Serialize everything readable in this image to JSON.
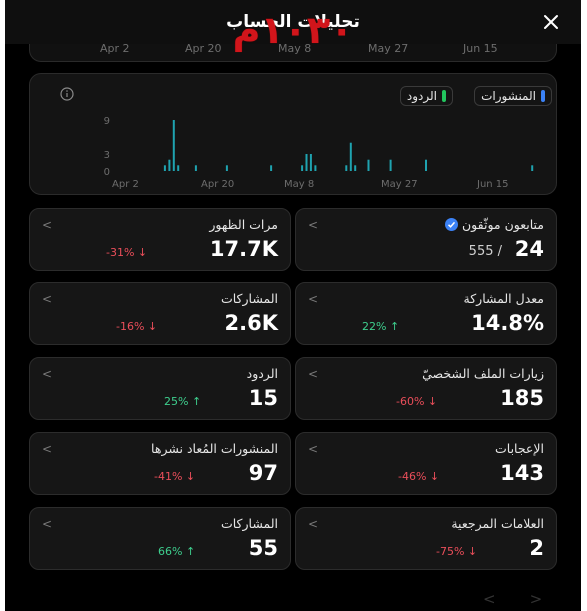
{
  "header": {
    "title": "تحليلات الحساب",
    "watermark": "١٠٣٠م"
  },
  "top_strip": {
    "dates": [
      "Apr 2",
      "Apr 20",
      "May 8",
      "May 27",
      "Jun 15"
    ]
  },
  "chart_data": {
    "type": "bar",
    "series": [
      {
        "name": "المنشورات",
        "color": "#3b82f6"
      },
      {
        "name": "الردود",
        "color": "#22c55e"
      }
    ],
    "x_ticks": [
      "Apr 2",
      "Apr 20",
      "May 8",
      "May 27",
      "Jun 15"
    ],
    "y_ticks": [
      0,
      3,
      9
    ],
    "ylim": [
      0,
      9
    ],
    "bars": [
      {
        "x": "Apr 16",
        "y": 1
      },
      {
        "x": "Apr 17",
        "y": 2
      },
      {
        "x": "Apr 18",
        "y": 9
      },
      {
        "x": "Apr 19",
        "y": 1
      },
      {
        "x": "Apr 23",
        "y": 1
      },
      {
        "x": "Apr 30",
        "y": 1
      },
      {
        "x": "May 10",
        "y": 1
      },
      {
        "x": "May 17",
        "y": 1
      },
      {
        "x": "May 18",
        "y": 3
      },
      {
        "x": "May 19",
        "y": 3
      },
      {
        "x": "May 20",
        "y": 1
      },
      {
        "x": "May 27",
        "y": 1
      },
      {
        "x": "May 28",
        "y": 5
      },
      {
        "x": "May 29",
        "y": 1
      },
      {
        "x": "Jun 1",
        "y": 2
      },
      {
        "x": "Jun 6",
        "y": 2
      },
      {
        "x": "Jun 14",
        "y": 2
      },
      {
        "x": "Jul 8",
        "y": 1
      }
    ],
    "legend_position": "top-right",
    "grid": false
  },
  "stats": {
    "verified_followers": {
      "label": "متابعون موثّقون",
      "value": "24",
      "sub": "555 /"
    },
    "impressions": {
      "label": "مرات الظهور",
      "value": "17.7K",
      "change": "-31% ↓"
    },
    "engagement_rate": {
      "label": "معدل المشاركة",
      "value": "14.8%",
      "change": "22% ↑"
    },
    "engagements": {
      "label": "المشاركات",
      "value": "2.6K",
      "change": "-16% ↓"
    },
    "profile_visits": {
      "label": "زيارات الملف الشخصيّ",
      "value": "185",
      "change": "-60% ↓"
    },
    "replies": {
      "label": "الردود",
      "value": "15",
      "change": "25% ↑"
    },
    "likes": {
      "label": "الإعجابات",
      "value": "143",
      "change": "-46% ↓"
    },
    "reposts": {
      "label": "المنشورات المُعاد نشرها",
      "value": "97",
      "change": "-41% ↓"
    },
    "bookmarks": {
      "label": "العلامات المرجعية",
      "value": "2",
      "change": "-75% ↓"
    },
    "shares": {
      "label": "المشاركات",
      "value": "55",
      "change": "66% ↑"
    }
  },
  "icons": {
    "close": "close-icon",
    "info": "info-icon",
    "chevron": "chevron-left-icon",
    "verified": "verified-badge-icon"
  },
  "colors": {
    "negative": "#ea4e5a",
    "positive": "#3ecf8e",
    "bar": "#1fa3b0"
  }
}
